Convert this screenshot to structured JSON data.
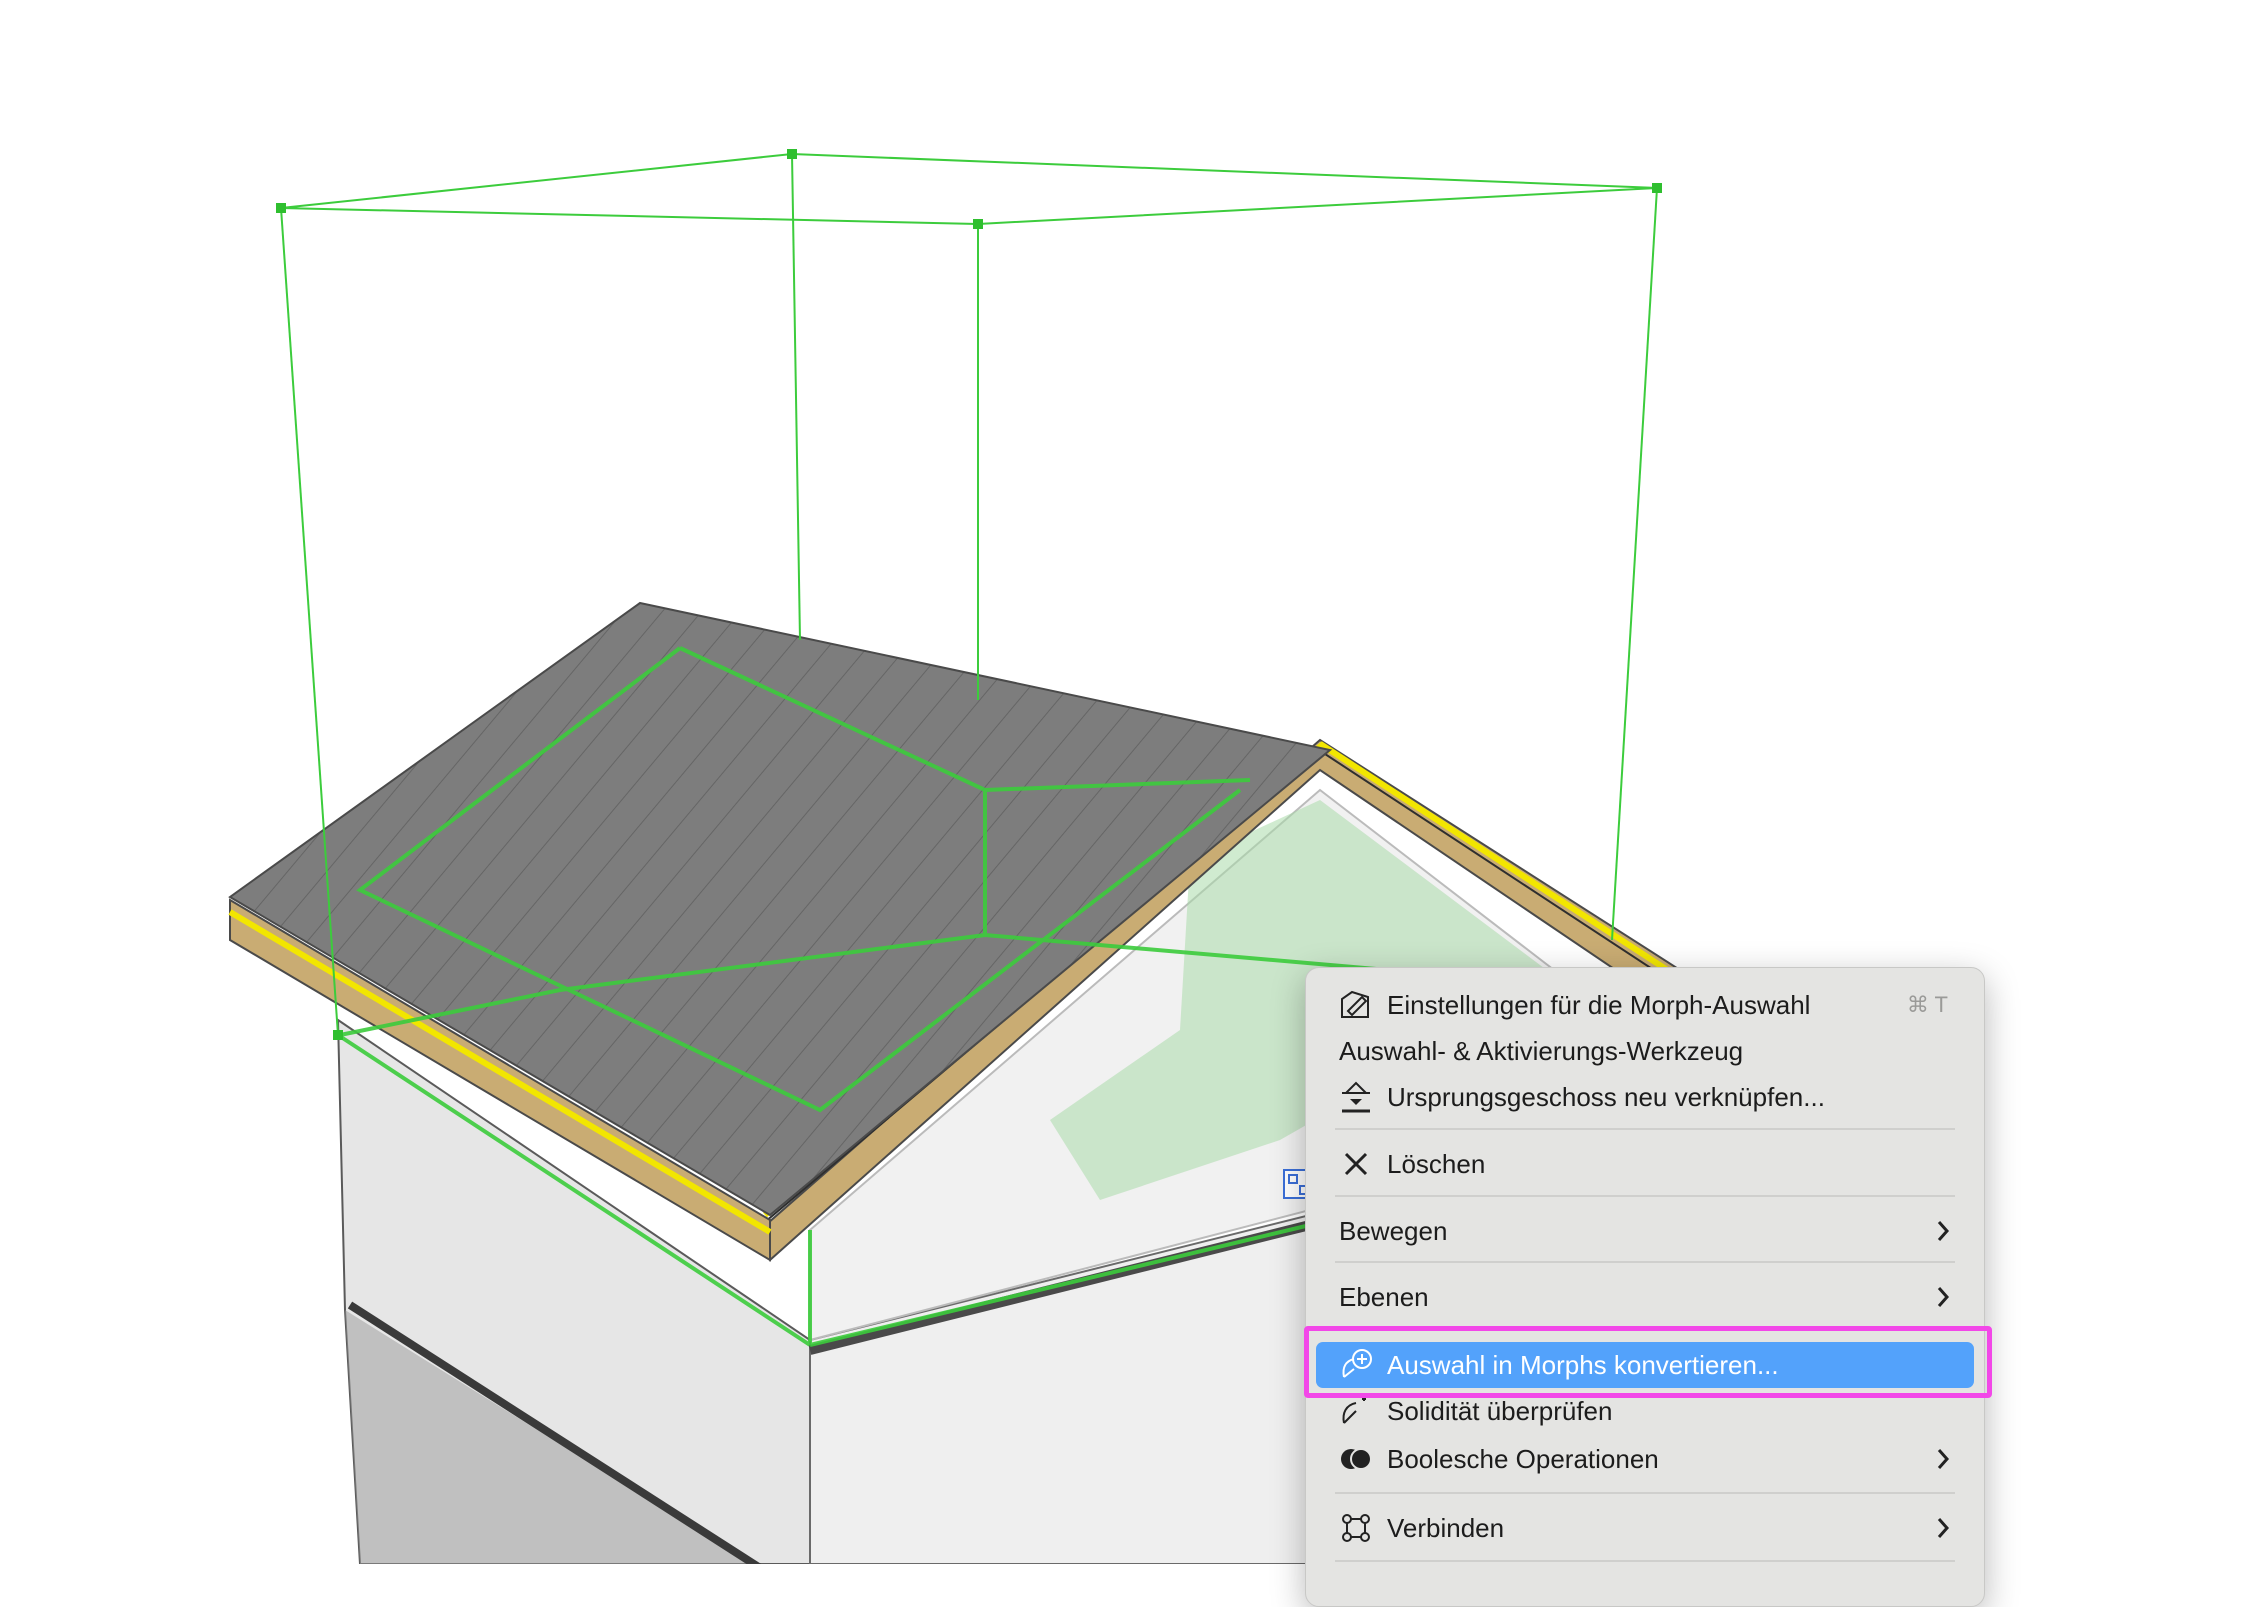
{
  "context_menu": {
    "items": [
      {
        "id": "morph-settings",
        "label": "Einstellungen für die Morph-Auswahl",
        "icon": "morph-settings-icon",
        "shortcut": "⌘ T"
      },
      {
        "id": "selection-tool",
        "label": "Auswahl- & Aktivierungs-Werkzeug"
      },
      {
        "id": "relink-story",
        "label": "Ursprungsgeschoss neu verknüpfen...",
        "icon": "home-story-icon"
      },
      {
        "id": "delete",
        "label": "Löschen",
        "icon": "close-icon"
      },
      {
        "id": "move",
        "label": "Bewegen",
        "submenu": true
      },
      {
        "id": "layers",
        "label": "Ebenen",
        "submenu": true
      },
      {
        "id": "convert-to-morph",
        "label": "Auswahl in Morphs konvertieren...",
        "icon": "convert-morph-icon",
        "highlighted": true
      },
      {
        "id": "check-solidity",
        "label": "Solidität überprüfen",
        "icon": "solidity-check-icon"
      },
      {
        "id": "boolean-ops",
        "label": "Boolesche Operationen",
        "icon": "boolean-icon",
        "submenu": true
      },
      {
        "id": "connect",
        "label": "Verbinden",
        "icon": "connect-icon",
        "submenu": true
      }
    ]
  },
  "colors": {
    "menu_background": "#e4e4e2",
    "selection_highlight": "#53a2fb",
    "annotation_box": "#f247e8",
    "selection_wireframe": "#3ccc3c",
    "roof_surface": "#7d7d7d",
    "roof_edge_yellow": "#f2e600",
    "roof_wood": "#c9ac73"
  }
}
